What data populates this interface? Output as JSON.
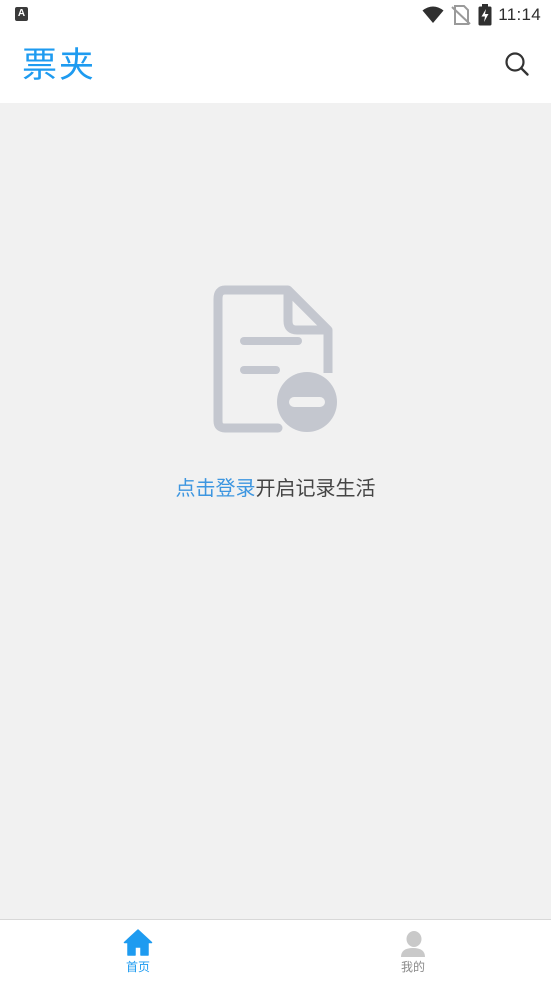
{
  "status_bar": {
    "indicator": "A",
    "time": "11:14",
    "icons": [
      "wifi-icon",
      "no-sim-icon",
      "battery-charging-icon"
    ]
  },
  "app_bar": {
    "title": "票夹",
    "search_icon": "search-icon"
  },
  "empty_state": {
    "icon": "document-remove-icon",
    "login_link": "点击登录",
    "message": "开启记录生活"
  },
  "bottom_nav": {
    "items": [
      {
        "label": "首页",
        "icon": "home-icon",
        "active": true
      },
      {
        "label": "我的",
        "icon": "profile-icon",
        "active": false
      }
    ]
  },
  "colors": {
    "accent": "#1e9bf0",
    "link": "#3d96e0",
    "background": "#f1f1f1",
    "icon_gray": "#c4c7cf"
  }
}
